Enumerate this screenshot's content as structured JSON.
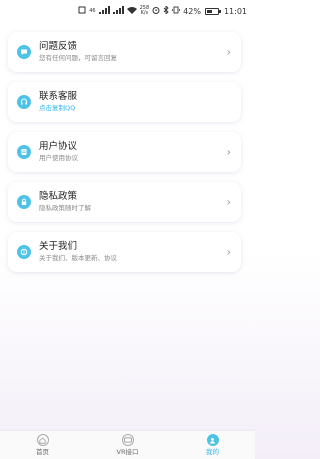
{
  "status_bar": {
    "signal_text": "46",
    "speed_line1": "258",
    "speed_line2": "K/s",
    "battery": "42%",
    "time": "11:01"
  },
  "colors": {
    "accent": "#4fc3e6",
    "accent_text": "#33b6ec"
  },
  "menu": [
    {
      "title": "问题反馈",
      "subtitle": "您有任何问题，可留言回复",
      "icon": "feedback-icon",
      "accent": false
    },
    {
      "title": "联系客服",
      "subtitle": "点击复制QQ",
      "icon": "customer-service-icon",
      "accent": true
    },
    {
      "title": "用户协议",
      "subtitle": "用户使用协议",
      "icon": "agreement-icon",
      "accent": false
    },
    {
      "title": "隐私政策",
      "subtitle": "隐私政策随时了解",
      "icon": "privacy-lock-icon",
      "accent": false
    },
    {
      "title": "关于我们",
      "subtitle": "关于我们、版本更新、协议",
      "icon": "about-icon",
      "accent": false
    }
  ],
  "chevron": "›",
  "tabs": [
    {
      "label": "首页",
      "icon": "home-icon",
      "active": false
    },
    {
      "label": "VR接口",
      "icon": "vr-icon",
      "active": false
    },
    {
      "label": "我的",
      "icon": "profile-icon",
      "active": true
    }
  ]
}
